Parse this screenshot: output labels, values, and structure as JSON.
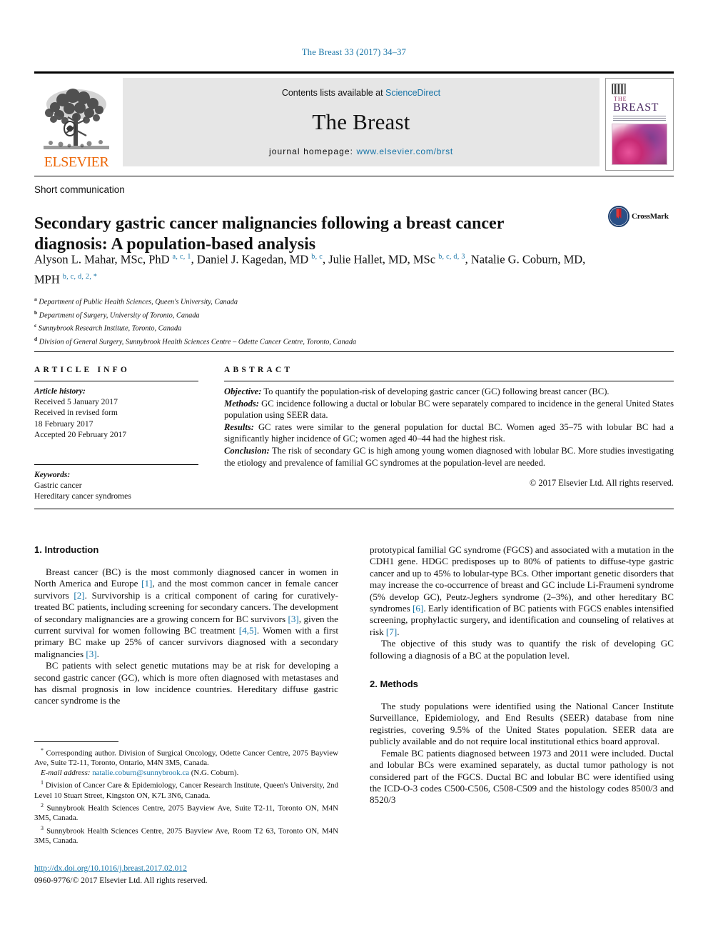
{
  "running_head": "The Breast 33 (2017) 34–37",
  "masthead": {
    "publisher": "ELSEVIER",
    "contents_prefix": "Contents lists available at ",
    "contents_link": "ScienceDirect",
    "journal_name": "The Breast",
    "homepage_prefix": "journal homepage: ",
    "homepage_url": "www.elsevier.com/brst",
    "cover": {
      "the": "THE",
      "breast": "BREAST"
    },
    "link_color": "#1673a6",
    "elsevier_orange": "#ec6607"
  },
  "article": {
    "type": "Short communication",
    "title": "Secondary gastric cancer malignancies following a breast cancer diagnosis: A population-based analysis",
    "crossmark_label": "CrossMark",
    "authors_html": "Alyson L. Mahar, MSc, PhD <sup>a, c, 1</sup>, Daniel J. Kagedan, MD <sup>b, c</sup>, Julie Hallet, MD, MSc <sup>b, c, d, 3</sup>, Natalie G. Coburn, MD, MPH <sup>b, c, d, 2, *</sup>",
    "affiliations": [
      {
        "mark": "a",
        "text": "Department of Public Health Sciences, Queen's University, Canada"
      },
      {
        "mark": "b",
        "text": "Department of Surgery, University of Toronto, Canada"
      },
      {
        "mark": "c",
        "text": "Sunnybrook Research Institute, Toronto, Canada"
      },
      {
        "mark": "d",
        "text": "Division of General Surgery, Sunnybrook Health Sciences Centre – Odette Cancer Centre, Toronto, Canada"
      }
    ]
  },
  "article_info": {
    "heading": "ARTICLE INFO",
    "history_label": "Article history:",
    "history_lines": [
      "Received 5 January 2017",
      "Received in revised form",
      "18 February 2017",
      "Accepted 20 February 2017"
    ],
    "keywords_label": "Keywords:",
    "keywords": [
      "Gastric cancer",
      "Hereditary cancer syndromes"
    ]
  },
  "abstract": {
    "heading": "ABSTRACT",
    "sections": [
      {
        "label": "Objective:",
        "text": " To quantify the population-risk of developing gastric cancer (GC) following breast cancer (BC)."
      },
      {
        "label": "Methods:",
        "text": " GC incidence following a ductal or lobular BC were separately compared to incidence in the general United States population using SEER data."
      },
      {
        "label": "Results:",
        "text": " GC rates were similar to the general population for ductal BC. Women aged 35–75 with lobular BC had a significantly higher incidence of GC; women aged 40–44 had the highest risk."
      },
      {
        "label": "Conclusion:",
        "text": " The risk of secondary GC is high among young women diagnosed with lobular BC. More studies investigating the etiology and prevalence of familial GC syndromes at the population-level are needed."
      }
    ],
    "copyright": "© 2017 Elsevier Ltd. All rights reserved."
  },
  "body": {
    "intro_heading": "1. Introduction",
    "intro_p1_html": "Breast cancer (BC) is the most commonly diagnosed cancer in women in North America and Europe <span class=\"ref\">[1]</span>, and the most common cancer in female cancer survivors <span class=\"ref\">[2]</span>. Survivorship is a critical component of caring for curatively-treated BC patients, including screening for secondary cancers. The development of secondary malignancies are a growing concern for BC survivors <span class=\"ref\">[3]</span>, given the current survival for women following BC treatment <span class=\"ref\">[4,5]</span>. Women with a first primary BC make up 25% of cancer survivors diagnosed with a secondary malignancies <span class=\"ref\">[3]</span>.",
    "intro_p2_html": "BC patients with select genetic mutations may be at risk for developing a second gastric cancer (GC), which is more often diagnosed with metastases and has dismal prognosis in low incidence countries. Hereditary diffuse gastric cancer syndrome is the",
    "right_p1_html": "prototypical familial GC syndrome (FGCS) and associated with a mutation in the CDH1 gene. HDGC predisposes up to 80% of patients to diffuse-type gastric cancer and up to 45% to lobular-type BCs. Other important genetic disorders that may increase the co-occurrence of breast and GC include Li-Fraumeni syndrome (5% develop GC), Peutz-Jeghers syndrome (2–3%), and other hereditary BC syndromes <span class=\"ref\">[6]</span>. Early identification of BC patients with FGCS enables intensified screening, prophylactic surgery, and identification and counseling of relatives at risk <span class=\"ref\">[7]</span>.",
    "right_p2_html": "The objective of this study was to quantify the risk of developing GC following a diagnosis of a BC at the population level.",
    "methods_heading": "2. Methods",
    "methods_p1_html": "The study populations were identified using the National Cancer Institute Surveillance, Epidemiology, and End Results (SEER) database from nine registries, covering 9.5% of the United States population. SEER data are publicly available and do not require local institutional ethics board approval.",
    "methods_p2_html": "Female BC patients diagnosed between 1973 and 2011 were included. Ductal and lobular BCs were examined separately, as ductal tumor pathology is not considered part of the FGCS. Ductal BC and lobular BC were identified using the ICD-O-3 codes C500-C506, C508-C509 and the histology codes 8500/3 and 8520/3"
  },
  "footnotes": {
    "corresponding_html": "<sup>*</sup> Corresponding author. Division of Surgical Oncology, Odette Cancer Centre, 2075 Bayview Ave, Suite T2-11, Toronto, Ontario, M4N 3M5, Canada.",
    "email_label": "E-mail address:",
    "email": "natalie.coburn@sunnybrook.ca",
    "email_suffix": " (N.G. Coburn).",
    "notes": [
      {
        "mark": "1",
        "text": "Division of Cancer Care & Epidemiology, Cancer Research Institute, Queen's University, 2nd Level 10 Stuart Street, Kingston ON, K7L 3N6, Canada."
      },
      {
        "mark": "2",
        "text": "Sunnybrook Health Sciences Centre, 2075 Bayview Ave, Suite T2-11, Toronto ON, M4N 3M5, Canada."
      },
      {
        "mark": "3",
        "text": "Sunnybrook Health Sciences Centre, 2075 Bayview Ave, Room T2 63, Toronto ON, M4N 3M5, Canada."
      }
    ]
  },
  "footer": {
    "doi": "http://dx.doi.org/10.1016/j.breast.2017.02.012",
    "issn_line": "0960-9776/© 2017 Elsevier Ltd. All rights reserved."
  }
}
